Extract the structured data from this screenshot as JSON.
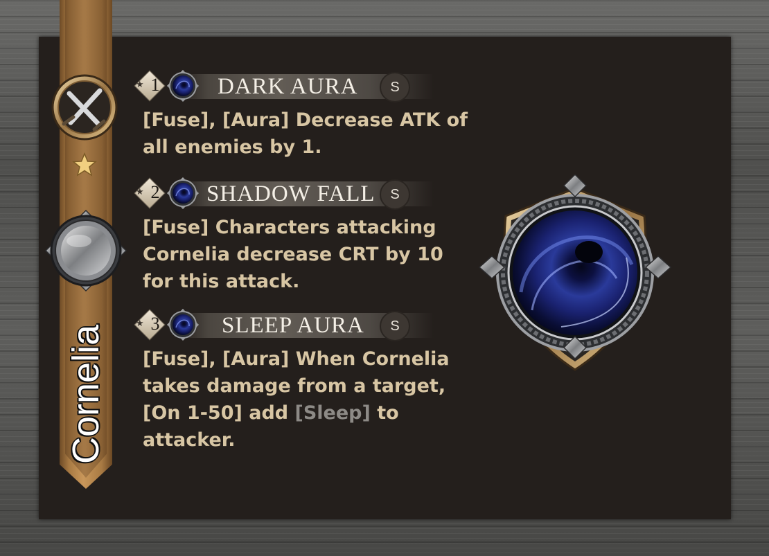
{
  "character": {
    "name": "Cornelia"
  },
  "ribbon_icons": {
    "class_icon": "crossed-swords-icon",
    "rank_icon": "star-icon",
    "element_icon": "steel-orb-icon"
  },
  "skills": [
    {
      "number": "1",
      "name": "DARK AURA",
      "badge": "S",
      "icon": "dark-vortex-icon",
      "description": "[Fuse], [Aura] Decrease ATK of all enemies by 1."
    },
    {
      "number": "2",
      "name": "SHADOW FALL",
      "badge": "S",
      "icon": "dark-vortex-icon",
      "description": "[Fuse] Characters attacking Cornelia decrease CRT by 10 for this attack."
    },
    {
      "number": "3",
      "name": "SLEEP AURA",
      "badge": "S",
      "icon": "dark-vortex-icon",
      "description_before": "[Fuse], [Aura] When Cornelia takes damage from a target, [On 1-50] add ",
      "description_status": "[Sleep]",
      "description_after": " to attacker."
    }
  ],
  "emblem": {
    "icon": "dark-vortex-emblem-icon"
  },
  "colors": {
    "panel": "#241f1c",
    "ribbon_gold": "#c9975a",
    "desc_text": "#d8c6a4",
    "status_gray": "#8d8a86"
  }
}
